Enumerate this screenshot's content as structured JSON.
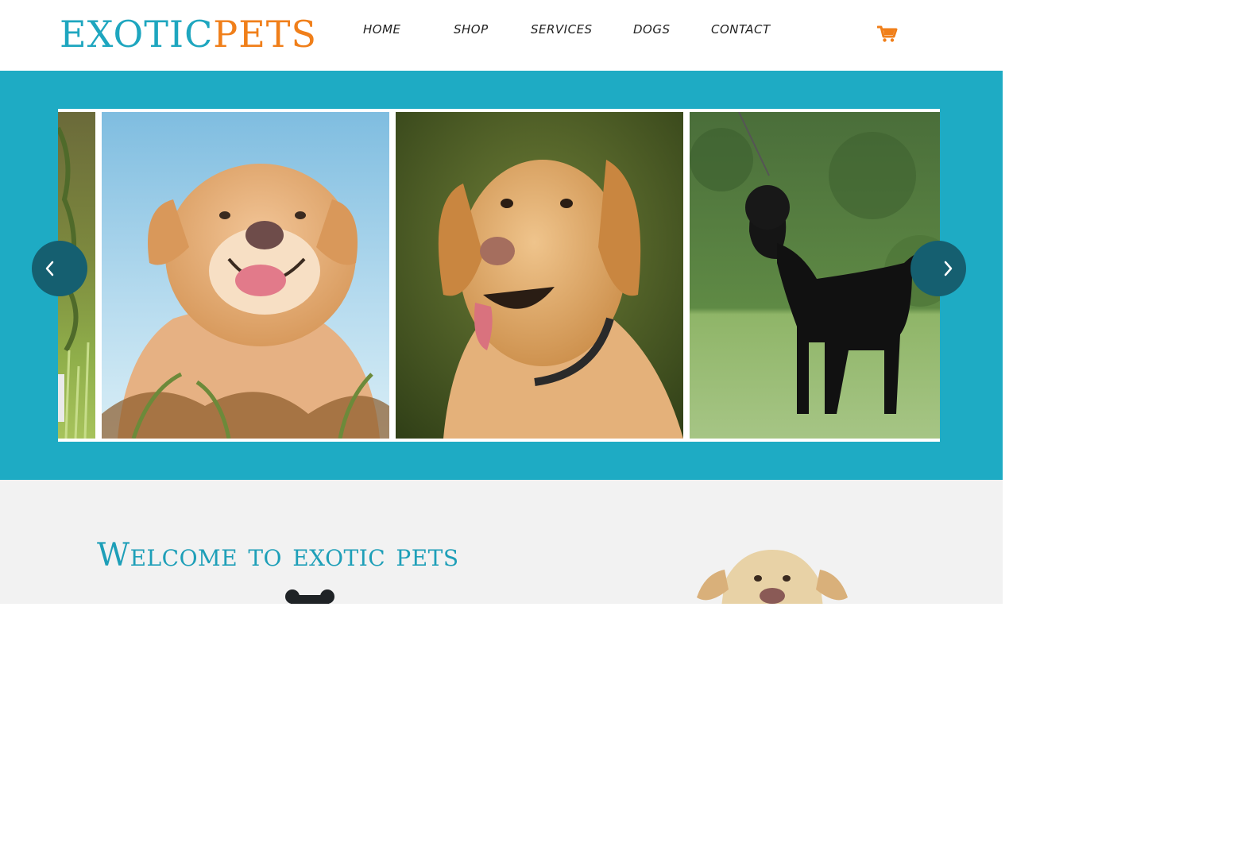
{
  "brand": {
    "part1": "EXOTIC",
    "part2": "PETS",
    "color1": "#1ea6bf",
    "color2": "#f07f1a"
  },
  "nav": {
    "items": [
      {
        "label": "HOME"
      },
      {
        "label": "SHOP"
      },
      {
        "label": "SERVICES"
      },
      {
        "label": "DOGS"
      },
      {
        "label": "CONTACT"
      }
    ],
    "cart_icon": "shopping-cart-icon"
  },
  "hero": {
    "background": "#1eabc4",
    "slides": [
      {
        "subject": "golden labrador in grass (partial)"
      },
      {
        "subject": "smiling golden labrador, blue sky"
      },
      {
        "subject": "golden labrador with collar, green background"
      },
      {
        "subject": "black labrador on leash standing on grass"
      }
    ],
    "prev_icon": "chevron-left-icon",
    "next_icon": "chevron-right-icon"
  },
  "welcome": {
    "title": "Welcome to exotic pets",
    "bone_icon": "dog-bone-icon"
  }
}
